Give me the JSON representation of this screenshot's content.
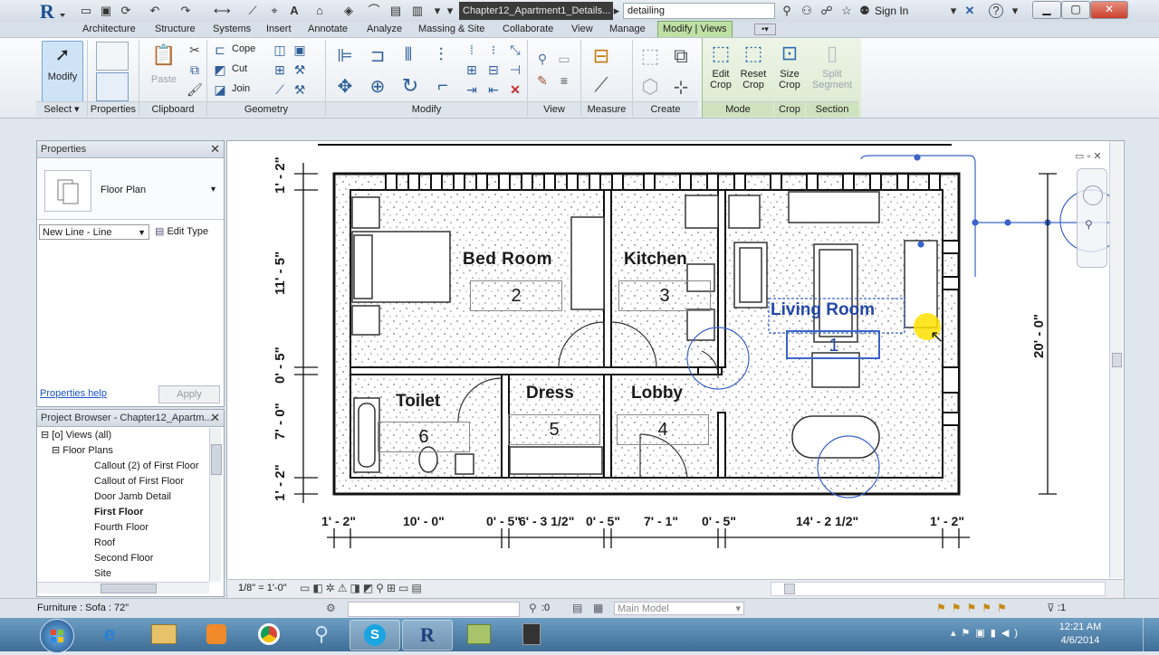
{
  "titlebar": {
    "document_title": "Chapter12_Apartment1_Details...",
    "search_text": "detailing",
    "sign_in": "Sign In"
  },
  "tabs": [
    "Architecture",
    "Structure",
    "Systems",
    "Insert",
    "Annotate",
    "Analyze",
    "Massing & Site",
    "Collaborate",
    "View",
    "Manage",
    "Modify | Views"
  ],
  "ribbon": {
    "modify_label": "Modify",
    "paste_label": "Paste",
    "cope_label": "Cope",
    "cut_label": "Cut",
    "join_label": "Join",
    "edit_crop": [
      "Edit",
      "Crop"
    ],
    "reset_crop": [
      "Reset",
      "Crop"
    ],
    "size_crop": [
      "Size",
      "Crop"
    ],
    "split_segment": [
      "Split",
      "Segment"
    ],
    "panels": [
      "Select",
      "Properties",
      "Clipboard",
      "Geometry",
      "Modify",
      "View",
      "Measure",
      "Create",
      "Mode",
      "Crop",
      "Section"
    ]
  },
  "properties": {
    "header": "Properties",
    "type_name": "Floor Plan",
    "selector": "New Line - Line",
    "edit_type": "Edit Type",
    "help_link": "Properties help",
    "apply": "Apply"
  },
  "project_browser": {
    "header": "Project Browser - Chapter12_Apartm...",
    "root": "Views (all)",
    "group": "Floor Plans",
    "items": [
      "Callout (2) of First Floor",
      "Callout of First Floor",
      "Door Jamb Detail",
      "First Floor",
      "Fourth Floor",
      "Roof",
      "Second Floor",
      "Site"
    ],
    "selected_item": "First Floor"
  },
  "plan": {
    "rooms": [
      {
        "name": "Bed Room",
        "number": "2"
      },
      {
        "name": "Kitchen",
        "number": "3"
      },
      {
        "name": "Living Room",
        "number": "1"
      },
      {
        "name": "Toilet",
        "number": "6"
      },
      {
        "name": "Dress",
        "number": "5"
      },
      {
        "name": "Lobby",
        "number": "4"
      }
    ],
    "dims_left": [
      "1' - 2\"",
      "11' - 5\"",
      "0' - 5\"",
      "7' - 0\"",
      "1' - 2\""
    ],
    "dims_right": "20' - 0\"",
    "dims_bottom": [
      "1' - 2\"",
      "10' - 0\"",
      "0' - 5\"",
      "6' - 3 1/2\"",
      "0' - 5\"",
      "7' - 1\"",
      "0' - 5\"",
      "14' - 2 1/2\"",
      "1' - 2\""
    ]
  },
  "viewbar": {
    "scale": "1/8\" = 1'-0\""
  },
  "statusbar": {
    "status": "Furniture : Sofa : 72\"",
    "worksets": ":0",
    "model": "Main Model",
    "filter_count": ":1"
  },
  "taskbar": {
    "time": "12:21 AM",
    "date": "4/6/2014"
  }
}
